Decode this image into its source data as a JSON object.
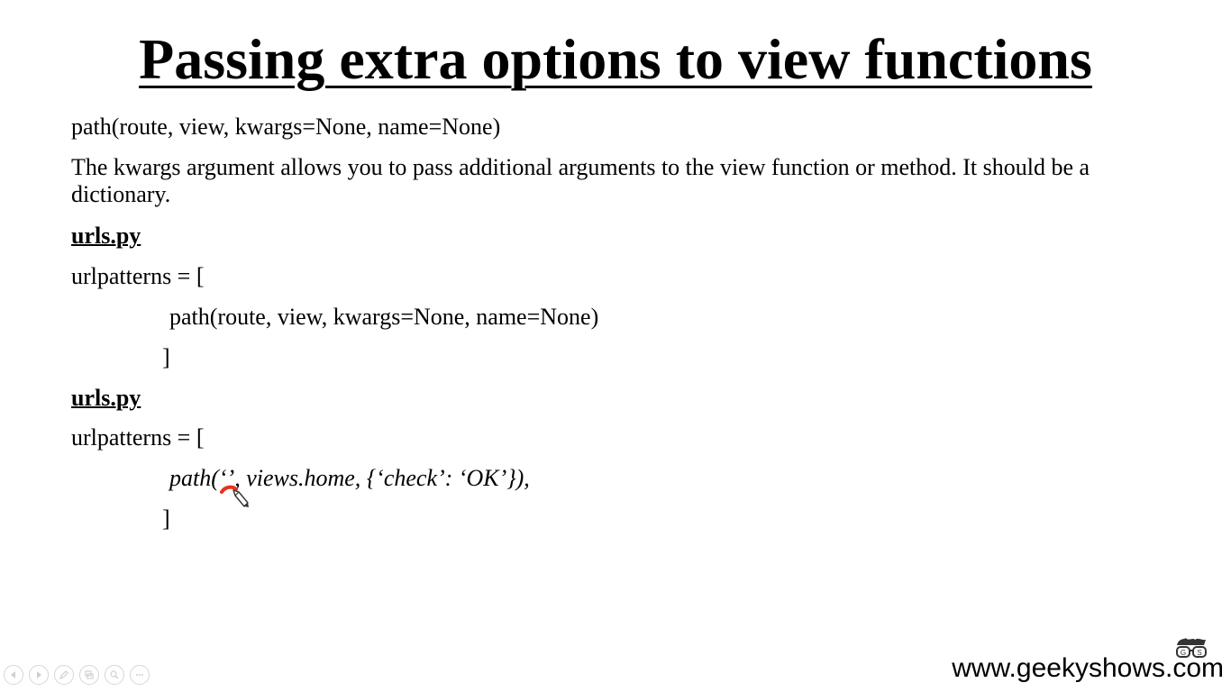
{
  "slide": {
    "title": "Passing extra options to view functions",
    "signature": "path(route, view, kwargs=None, name=None)",
    "description": "The kwargs argument allows you to pass additional arguments to the view function or method. It should be a dictionary.",
    "example1": {
      "heading": "urls.py",
      "open": "urlpatterns = [",
      "body": "path(route, view, kwargs=None, name=None)",
      "close": "]"
    },
    "example2": {
      "heading": "urls.py",
      "open": "urlpatterns = [",
      "body": "path(‘’, views.home, {‘check’: ‘OK’}),",
      "close": "]"
    }
  },
  "annotation": {
    "color": "#e8311e",
    "icon": "pen-cursor-icon"
  },
  "controls": {
    "icons": [
      "previous-icon",
      "next-icon",
      "pen-icon",
      "slides-icon",
      "zoom-icon",
      "more-icon"
    ]
  },
  "branding": {
    "website": "www.geekyshows.com",
    "logo": "geekyshows-logo-icon"
  }
}
